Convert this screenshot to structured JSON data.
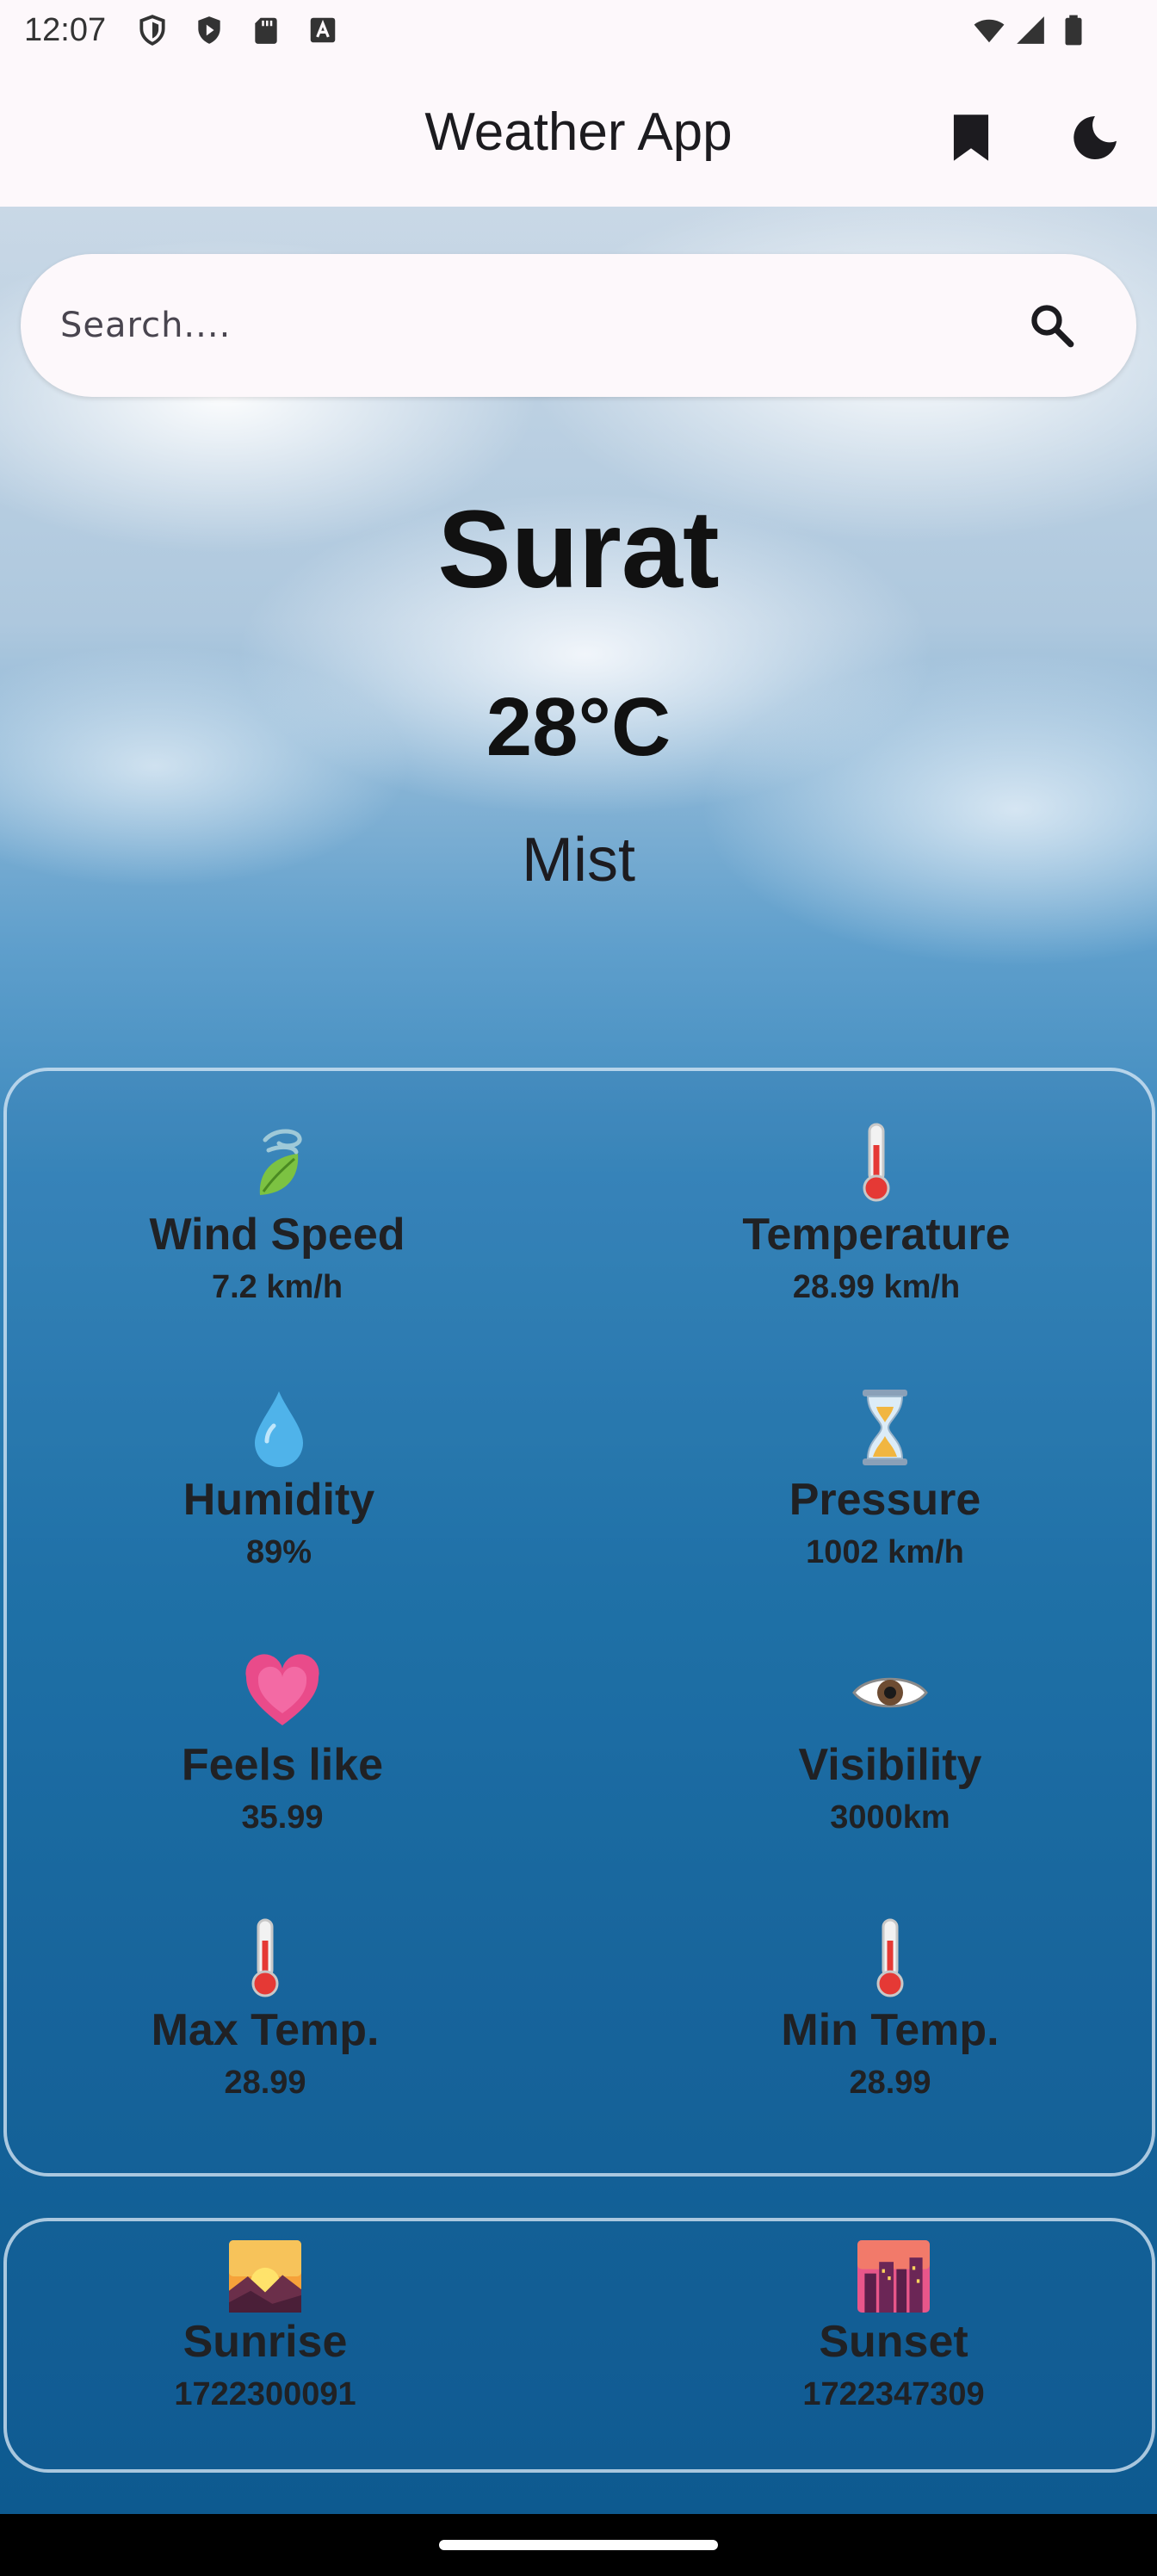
{
  "status_bar": {
    "time": "12:07",
    "icons_left": [
      "shield-icon",
      "play-protect-icon",
      "sd-card-icon",
      "a-font-icon"
    ],
    "icons_right": [
      "wifi-icon",
      "cell-signal-icon",
      "battery-icon"
    ]
  },
  "app_bar": {
    "title": "Weather App",
    "actions": [
      "bookmark-icon",
      "dark-mode-moon-icon"
    ]
  },
  "search": {
    "placeholder": "Search....",
    "value": "",
    "button_icon": "search-icon"
  },
  "weather": {
    "city": "Surat",
    "temperature": "28°C",
    "description": "Mist"
  },
  "stats": [
    {
      "icon": "leaf-wind-icon",
      "label": "Wind Speed",
      "value": "7.2 km/h"
    },
    {
      "icon": "thermometer-icon",
      "label": "Temperature",
      "value": "28.99 km/h"
    },
    {
      "icon": "droplet-icon",
      "label": "Humidity",
      "value": "89%"
    },
    {
      "icon": "hourglass-icon",
      "label": "Pressure",
      "value": "1002 km/h"
    },
    {
      "icon": "heart-icon",
      "label": "Feels like",
      "value": "35.99"
    },
    {
      "icon": "eye-icon",
      "label": "Visibility",
      "value": "3000km"
    },
    {
      "icon": "thermometer-icon",
      "label": "Max Temp.",
      "value": "28.99"
    },
    {
      "icon": "thermometer-icon",
      "label": "Min Temp.",
      "value": "28.99"
    }
  ],
  "sun": [
    {
      "icon": "sunrise-icon",
      "label": "Sunrise",
      "value": "1722300091"
    },
    {
      "icon": "sunset-city-icon",
      "label": "Sunset",
      "value": "1722347309"
    }
  ],
  "colors": {
    "app_bar_bg": "#fdf8fb",
    "sky_top": "#c9d8e6",
    "sky_bottom": "#0d5a90",
    "card_border": "#dcebf8"
  }
}
